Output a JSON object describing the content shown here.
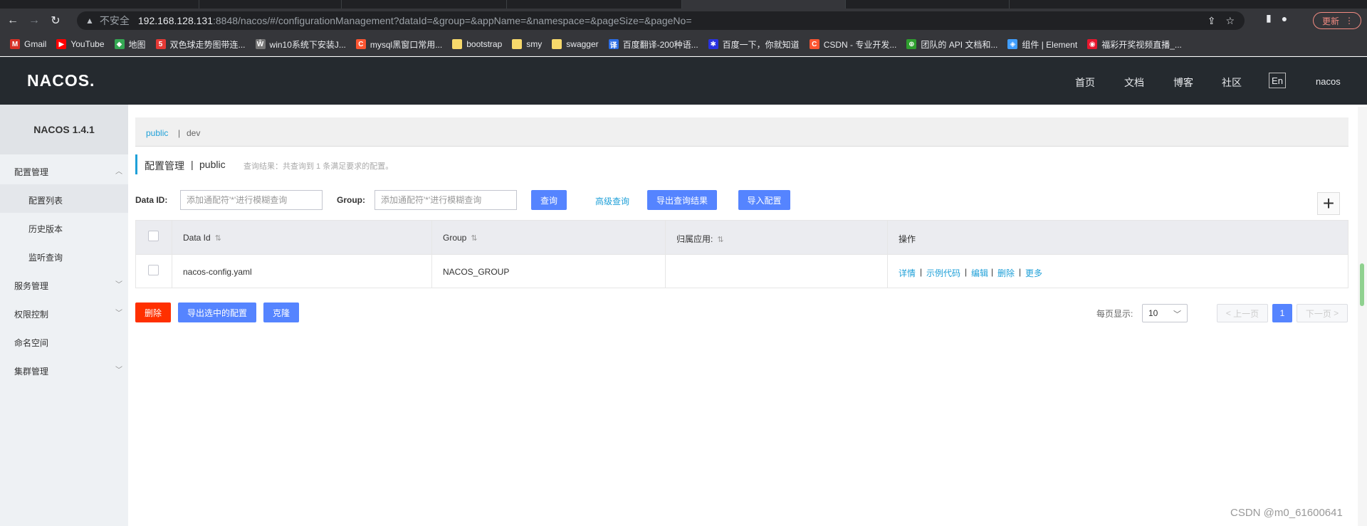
{
  "browser": {
    "url_insecure_label": "不安全",
    "url_host": "192.168.128.131",
    "url_rest": ":8848/nacos/#/configurationManagement?dataId=&group=&appName=&namespace=&pageSize=&pageNo=",
    "update_label": "更新",
    "bookmarks": [
      {
        "label": "Gmail",
        "icon": "gmail-icon",
        "color": "#d93025",
        "glyph": "M"
      },
      {
        "label": "YouTube",
        "icon": "youtube-icon",
        "color": "#ff0000",
        "glyph": "▶"
      },
      {
        "label": "地图",
        "icon": "maps-icon",
        "color": "#34a853",
        "glyph": "◆"
      },
      {
        "label": "双色球走势图带连...",
        "icon": "lottery-icon",
        "color": "#e53935",
        "glyph": "5"
      },
      {
        "label": "win10系统下安装J...",
        "icon": "win10-icon",
        "color": "#777777",
        "glyph": "Ŵ"
      },
      {
        "label": "mysql黑窗口常用...",
        "icon": "csdn-icon",
        "color": "#fc5531",
        "glyph": "C"
      },
      {
        "label": "bootstrap",
        "icon": "folder-icon",
        "color": "#f7d96b",
        "glyph": ""
      },
      {
        "label": "smy",
        "icon": "folder-icon",
        "color": "#f7d96b",
        "glyph": ""
      },
      {
        "label": "swagger",
        "icon": "folder-icon",
        "color": "#f7d96b",
        "glyph": ""
      },
      {
        "label": "百度翻译-200种语...",
        "icon": "baidu-translate-icon",
        "color": "#2b6de5",
        "glyph": "译"
      },
      {
        "label": "百度一下，你就知道",
        "icon": "baidu-icon",
        "color": "#2932e1",
        "glyph": "✱"
      },
      {
        "label": "CSDN - 专业开发...",
        "icon": "csdn-icon",
        "color": "#fc5531",
        "glyph": "C"
      },
      {
        "label": "团队的 API 文档和...",
        "icon": "api-doc-icon",
        "color": "#2e9e2e",
        "glyph": "⊕"
      },
      {
        "label": "组件 | Element",
        "icon": "element-icon",
        "color": "#409eff",
        "glyph": "◈"
      },
      {
        "label": "福彩开奖视频直播_...",
        "icon": "weibo-icon",
        "color": "#e6162d",
        "glyph": "◉"
      }
    ]
  },
  "header": {
    "logo": "NACOS.",
    "nav": [
      "首页",
      "文档",
      "博客",
      "社区"
    ],
    "lang": "En",
    "user": "nacos"
  },
  "sidebar": {
    "title": "NACOS 1.4.1",
    "items": [
      {
        "label": "配置管理",
        "expanded": true
      },
      {
        "label": "配置列表",
        "sub": true,
        "active": true
      },
      {
        "label": "历史版本",
        "sub": true
      },
      {
        "label": "监听查询",
        "sub": true
      },
      {
        "label": "服务管理",
        "expanded": false
      },
      {
        "label": "权限控制",
        "expanded": false
      },
      {
        "label": "命名空间"
      },
      {
        "label": "集群管理",
        "expanded": false
      }
    ]
  },
  "namespace_bar": {
    "active": "public",
    "sep": "|",
    "other": "dev"
  },
  "page": {
    "title": "配置管理",
    "sep": "|",
    "namespace": "public",
    "note": "查询结果：共查询到 1 条满足要求的配置。"
  },
  "search": {
    "dataid_label": "Data ID:",
    "dataid_placeholder": "添加通配符'*'进行模糊查询",
    "group_label": "Group:",
    "group_placeholder": "添加通配符'*'进行模糊查询",
    "query_btn": "查询",
    "advanced_link": "高级查询",
    "export_btn": "导出查询结果",
    "import_btn": "导入配置",
    "add_icon": "plus-icon"
  },
  "table": {
    "headers": [
      "Data Id",
      "Group",
      "归属应用:",
      "操作"
    ],
    "rows": [
      {
        "data_id": "nacos-config.yaml",
        "group": "NACOS_GROUP",
        "app": "",
        "ops": [
          "详情",
          "示例代码",
          "编辑",
          "删除",
          "更多"
        ]
      }
    ]
  },
  "bulk": {
    "delete_btn": "删除",
    "export_selected_btn": "导出选中的配置",
    "clone_btn": "克隆"
  },
  "pagination": {
    "page_size_label": "每页显示:",
    "page_size": "10",
    "prev": "上一页",
    "current": "1",
    "next": "下一页"
  },
  "watermark": "CSDN @m0_61600641"
}
